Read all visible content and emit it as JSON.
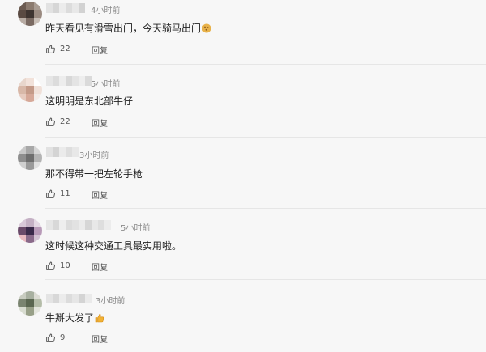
{
  "comments": [
    {
      "time": "4小时前",
      "text": "昨天看见有滑雪出门，今天骑马出门",
      "emoji": "cookie-emoji",
      "likes": "22",
      "reply_label": "回复"
    },
    {
      "time": "5小时前",
      "text": "这明明是东北部牛仔",
      "likes": "22",
      "reply_label": "回复"
    },
    {
      "time": "3小时前",
      "text": "那不得带一把左轮手枪",
      "likes": "11",
      "reply_label": "回复"
    },
    {
      "time": "5小时前",
      "text": "这时候这种交通工具最实用啦。",
      "likes": "10",
      "reply_label": "回复"
    },
    {
      "time": "3小时前",
      "text": "牛掰大发了",
      "emoji": "thumbs-up-emoji",
      "likes": "9",
      "reply_label": "回复"
    }
  ],
  "colors": {
    "background": "#f7f7f7",
    "text": "#222222",
    "meta": "#8a8a8a",
    "divider": "#e6e6e6"
  }
}
